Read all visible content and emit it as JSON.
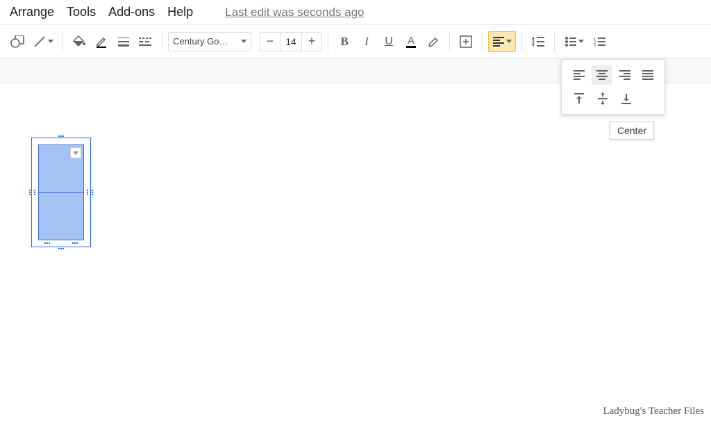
{
  "menu": {
    "arrange": "Arrange",
    "tools": "Tools",
    "addons": "Add-ons",
    "help": "Help",
    "last_edit": "Last edit was seconds ago"
  },
  "toolbar": {
    "font_name": "Century Go…",
    "font_size": "14"
  },
  "tooltip": {
    "center": "Center"
  },
  "watermark": "Ladybug's Teacher Files"
}
